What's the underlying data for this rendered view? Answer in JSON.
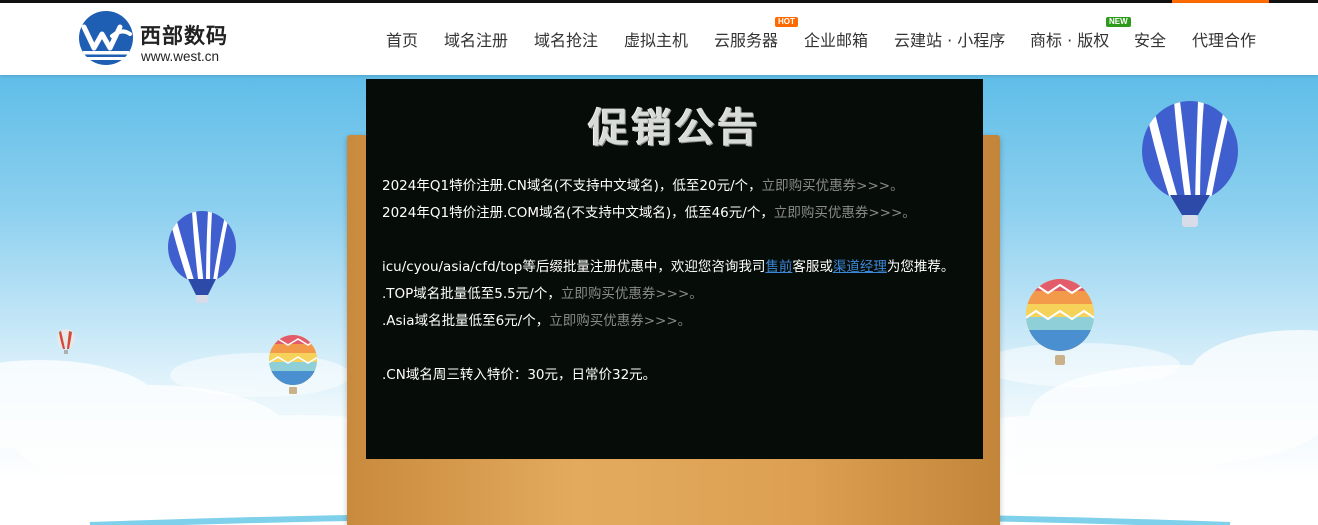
{
  "logo": {
    "name_cn": "西部数码",
    "domain": "www.west.cn",
    "icon": "west-logo-icon"
  },
  "nav": {
    "items": [
      {
        "label": "首页"
      },
      {
        "label": "域名注册"
      },
      {
        "label": "域名抢注"
      },
      {
        "label": "虚拟主机"
      },
      {
        "label": "云服务器",
        "badge": "HOT"
      },
      {
        "label": "企业邮箱"
      },
      {
        "label": "云建站 · 小程序"
      },
      {
        "label": "商标 · 版权",
        "badge": "NEW"
      },
      {
        "label": "安全"
      },
      {
        "label": "代理合作"
      }
    ]
  },
  "notice": {
    "title": "促销公告",
    "line1": {
      "text": "2024年Q1特价注册.CN域名(不支持中文域名)，低至20元/个，",
      "link": "立即购买优惠券>>>。"
    },
    "line2": {
      "text": "2024年Q1特价注册.COM域名(不支持中文域名)，低至46元/个，",
      "link": "立即购买优惠券>>>。"
    },
    "line3": {
      "prefix": "icu/cyou/asia/cfd/top等后缀批量注册优惠中，欢迎您咨询我司",
      "link_sales": "售前",
      "middle": "客服或",
      "link_manager": "渠道经理",
      "suffix": "为您推荐。"
    },
    "line4": {
      "text": ".TOP域名批量低至5.5元/个，",
      "link": "立即购买优惠券>>>。"
    },
    "line5": {
      "text": ".Asia域名批量低至6元/个，",
      "link": "立即购买优惠券>>>。"
    },
    "line6": {
      "text": ".CN域名周三转入特价：30元，日常价32元。"
    }
  },
  "colors": {
    "accent": "#ff6a00",
    "brand_blue": "#1f5fb3",
    "board": "#060d08",
    "frame": "#dda052",
    "hot_badge": "#ff6a00",
    "new_badge": "#2e9a1c"
  },
  "decor": {
    "balloons": [
      "blue-striped-balloon-icon",
      "rainbow-balloon-icon"
    ]
  }
}
